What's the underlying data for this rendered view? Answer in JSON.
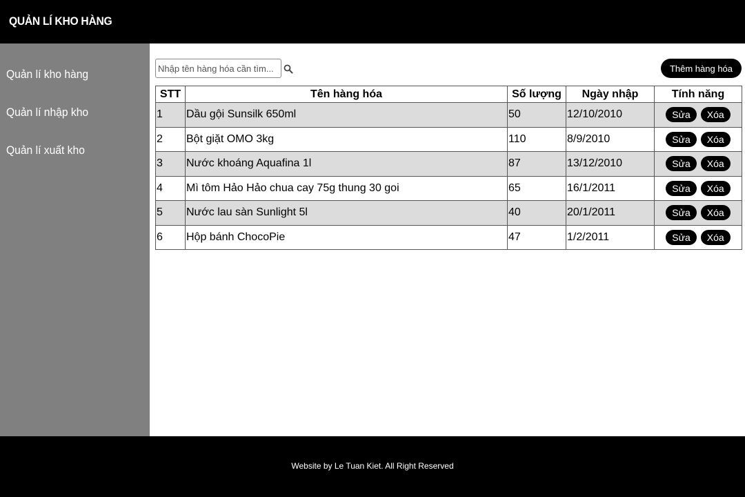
{
  "header": {
    "title": "QUẢN LÍ KHO HÀNG"
  },
  "sidebar": {
    "items": [
      {
        "label": "Quản lí kho hàng"
      },
      {
        "label": "Quản lí nhập kho"
      },
      {
        "label": "Quản lí xuất kho"
      }
    ]
  },
  "search": {
    "placeholder": "Nhập tên hàng hóa cần tìm...",
    "value": "",
    "icon": "search-icon"
  },
  "toolbar": {
    "add_label": "Thêm hàng hóa"
  },
  "table": {
    "columns": [
      "STT",
      "Tên hàng hóa",
      "Số lượng",
      "Ngày nhập",
      "Tính năng"
    ],
    "rows": [
      {
        "stt": "1",
        "name": "Dầu gội Sunsilk 650ml",
        "qty": "50",
        "date": "12/10/2010"
      },
      {
        "stt": "2",
        "name": "Bột giặt OMO 3kg",
        "qty": "110",
        "date": "8/9/2010"
      },
      {
        "stt": "3",
        "name": "Nước khoáng Aquafina 1l",
        "qty": "87",
        "date": "13/12/2010"
      },
      {
        "stt": "4",
        "name": "Mì tôm Hảo Hảo chua cay 75g thung 30 goi",
        "qty": "65",
        "date": "16/1/2011"
      },
      {
        "stt": "5",
        "name": "Nước lau sàn Sunlight 5l",
        "qty": "40",
        "date": "20/1/2011"
      },
      {
        "stt": "6",
        "name": "Hộp bánh ChocoPie",
        "qty": "47",
        "date": "1/2/2011"
      }
    ],
    "edit_label": "Sửa",
    "delete_label": "Xóa"
  },
  "footer": {
    "text": "Website by Le Tuan Kiet. All Right Reserved"
  },
  "colors": {
    "header_bg": "#000000",
    "sidebar_bg": "#808080",
    "row_alt_bg": "#dcdcdc",
    "button_bg": "#000000"
  }
}
